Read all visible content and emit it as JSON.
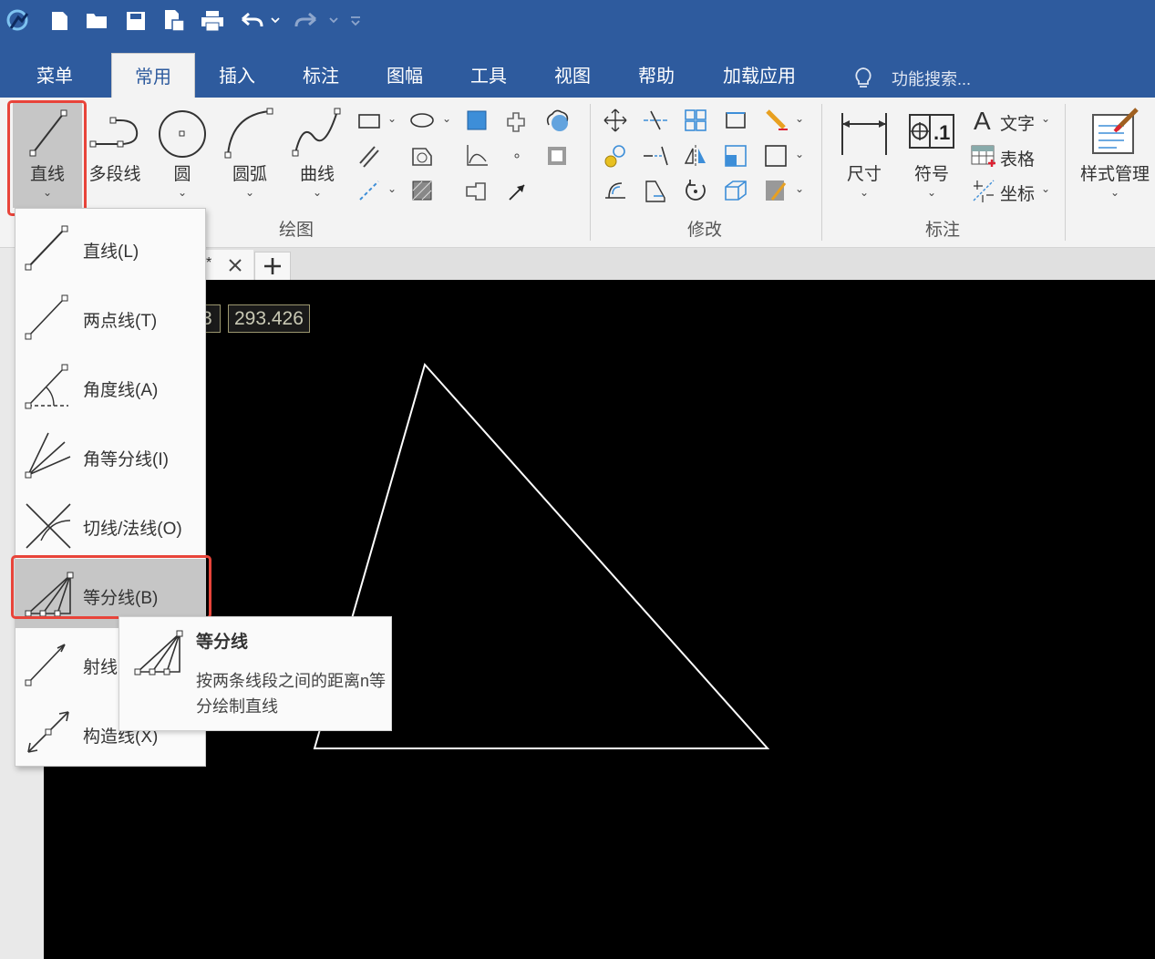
{
  "ribbon": {
    "tabs": [
      "菜单",
      "常用",
      "插入",
      "标注",
      "图幅",
      "工具",
      "视图",
      "帮助",
      "加载应用"
    ],
    "active_tab": "常用",
    "search_placeholder": "功能搜索...",
    "draw": {
      "line": "直线",
      "polyline": "多段线",
      "circle": "圆",
      "arc": "圆弧",
      "curve": "曲线",
      "group_label": "绘图"
    },
    "modify": {
      "group_label": "修改"
    },
    "annotate": {
      "dimension": "尺寸",
      "symbol": "符号",
      "text": "文字",
      "table": "表格",
      "coordinate": "坐标",
      "group_label": "标注"
    },
    "style_manager": "样式管理"
  },
  "canvas": {
    "coord_left": "3",
    "coord_right": "293.426"
  },
  "dropdown": {
    "items": [
      {
        "label": "直线(L)",
        "mnemonic": "L"
      },
      {
        "label": "两点线(T)",
        "mnemonic": "T"
      },
      {
        "label": "角度线(A)",
        "mnemonic": "A"
      },
      {
        "label": "角等分线(I)",
        "mnemonic": "I"
      },
      {
        "label": "切线/法线(O)",
        "mnemonic": "O"
      },
      {
        "label": "等分线(B)",
        "mnemonic": "B"
      },
      {
        "label": "射线",
        "mnemonic": ""
      },
      {
        "label": "构造线(X)",
        "mnemonic": "X"
      }
    ],
    "selected": "等分线(B)"
  },
  "tooltip": {
    "title": "等分线",
    "description": "按两条线段之间的距离n等分绘制直线"
  },
  "colors": {
    "title_bar": "#2e5b9e",
    "highlight": "#e8443a",
    "canvas": "#000000"
  }
}
